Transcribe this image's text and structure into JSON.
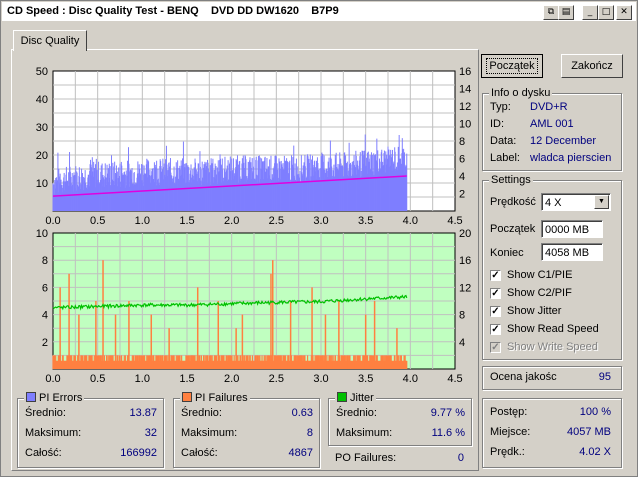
{
  "window": {
    "title": "CD Speed : Disc Quality Test - BENQ    DVD DD DW1620    B7P9"
  },
  "tabs": [
    {
      "label": "Disc Quality"
    }
  ],
  "buttons": {
    "start": "Początek",
    "exit": "Zakończ"
  },
  "disc_info": {
    "title": "Info o dysku",
    "rows": [
      {
        "label": "Typ:",
        "value": "DVD+R"
      },
      {
        "label": "ID:",
        "value": "AML 001"
      },
      {
        "label": "Data:",
        "value": "12 December"
      },
      {
        "label": "Label:",
        "value": "wladca pierscien"
      }
    ]
  },
  "settings": {
    "title": "Settings",
    "speed_label": "Prędkość",
    "speed_value": "4 X",
    "start_label": "Początek",
    "start_value": "0000 MB",
    "end_label": "Koniec",
    "end_value": "4058 MB",
    "checks": [
      {
        "label": "Show C1/PIE",
        "checked": true,
        "enabled": true
      },
      {
        "label": "Show C2/PIF",
        "checked": true,
        "enabled": true
      },
      {
        "label": "Show Jitter",
        "checked": true,
        "enabled": true
      },
      {
        "label": "Show Read Speed",
        "checked": true,
        "enabled": true
      },
      {
        "label": "Show Write Speed",
        "checked": true,
        "enabled": false
      }
    ]
  },
  "quality": {
    "label": "Ocena jakośc",
    "value": "95"
  },
  "progress": {
    "rows": [
      {
        "label": "Postęp:",
        "value": "100 %"
      },
      {
        "label": "Miejsce:",
        "value": "4057 MB"
      },
      {
        "label": "Prędk.:",
        "value": "4.02 X"
      }
    ]
  },
  "pi_errors": {
    "title": "PI Errors",
    "color": "#7f7fff",
    "rows": [
      {
        "label": "Średnio:",
        "value": "13.87"
      },
      {
        "label": "Maksimum:",
        "value": "32"
      },
      {
        "label": "Całość:",
        "value": "166992"
      }
    ]
  },
  "pi_failures": {
    "title": "PI Failures",
    "color": "#ff8040",
    "rows": [
      {
        "label": "Średnio:",
        "value": "0.63"
      },
      {
        "label": "Maksimum:",
        "value": "8"
      },
      {
        "label": "Całość:",
        "value": "4867"
      }
    ]
  },
  "jitter": {
    "title": "Jitter",
    "color": "#00c000",
    "rows": [
      {
        "label": "Średnio:",
        "value": "9.77 %"
      },
      {
        "label": "Maksimum:",
        "value": "11.6 %"
      }
    ]
  },
  "po_failures": {
    "label": "PO Failures:",
    "value": "0"
  },
  "chart_data": [
    {
      "type": "bar",
      "series_colors": {
        "pi_errors": "#7f7fff",
        "read_speed": "#e000e0"
      },
      "background": "#ffffff",
      "grid": true,
      "xlim": [
        0,
        4.5
      ],
      "x_ticks": [
        "0.0",
        "0.5",
        "1.0",
        "1.5",
        "2.0",
        "2.5",
        "3.0",
        "3.5",
        "4.0",
        "4.5"
      ],
      "ylim_left": [
        0,
        50
      ],
      "y_ticks_left": [
        "10",
        "20",
        "30",
        "40",
        "50"
      ],
      "ylim_right": [
        0,
        16
      ],
      "y_ticks_right": [
        "2",
        "4",
        "6",
        "8",
        "10",
        "12",
        "14",
        "16"
      ],
      "pi_errors_profile": [
        {
          "x": 0.0,
          "y": 10
        },
        {
          "x": 0.25,
          "y": 12
        },
        {
          "x": 0.5,
          "y": 13
        },
        {
          "x": 0.75,
          "y": 13
        },
        {
          "x": 1.0,
          "y": 14
        },
        {
          "x": 1.25,
          "y": 14
        },
        {
          "x": 1.5,
          "y": 14
        },
        {
          "x": 1.75,
          "y": 14
        },
        {
          "x": 2.0,
          "y": 15
        },
        {
          "x": 2.25,
          "y": 15
        },
        {
          "x": 2.5,
          "y": 15
        },
        {
          "x": 2.75,
          "y": 15
        },
        {
          "x": 3.0,
          "y": 16
        },
        {
          "x": 3.25,
          "y": 16
        },
        {
          "x": 3.5,
          "y": 17
        },
        {
          "x": 3.75,
          "y": 18
        },
        {
          "x": 3.96,
          "y": 19
        }
      ],
      "read_speed": [
        {
          "x": 0.0,
          "y": 1.7
        },
        {
          "x": 3.96,
          "y": 4.0
        }
      ],
      "data_end_x": 3.96
    },
    {
      "type": "bar",
      "series_colors": {
        "pi_failures": "#ff8040",
        "jitter": "#00c000"
      },
      "background": "#c0ffc0",
      "grid": true,
      "xlim": [
        0,
        4.5
      ],
      "x_ticks": [
        "0.0",
        "0.5",
        "1.0",
        "1.5",
        "2.0",
        "2.5",
        "3.0",
        "3.5",
        "4.0",
        "4.5"
      ],
      "ylim_left": [
        0,
        10
      ],
      "y_ticks_left": [
        "2",
        "4",
        "6",
        "8",
        "10"
      ],
      "ylim_right": [
        0,
        20
      ],
      "y_ticks_right": [
        "4",
        "8",
        "12",
        "16",
        "20"
      ],
      "pi_failures_profile": [
        {
          "x": 0.0,
          "y": 1
        },
        {
          "x": 0.5,
          "y": 1
        },
        {
          "x": 1.0,
          "y": 1
        },
        {
          "x": 1.5,
          "y": 1
        },
        {
          "x": 2.0,
          "y": 1
        },
        {
          "x": 2.5,
          "y": 1
        },
        {
          "x": 3.0,
          "y": 1
        },
        {
          "x": 3.5,
          "y": 1
        },
        {
          "x": 3.96,
          "y": 1
        }
      ],
      "pi_failures_spikes": [
        {
          "x": 0.08,
          "y": 6
        },
        {
          "x": 0.18,
          "y": 7
        },
        {
          "x": 0.29,
          "y": 4
        },
        {
          "x": 0.48,
          "y": 5
        },
        {
          "x": 0.56,
          "y": 8
        },
        {
          "x": 0.7,
          "y": 4
        },
        {
          "x": 0.85,
          "y": 5
        },
        {
          "x": 1.1,
          "y": 4
        },
        {
          "x": 1.3,
          "y": 3
        },
        {
          "x": 1.62,
          "y": 6
        },
        {
          "x": 1.85,
          "y": 5
        },
        {
          "x": 2.05,
          "y": 3
        },
        {
          "x": 2.12,
          "y": 4
        },
        {
          "x": 2.44,
          "y": 7
        },
        {
          "x": 2.46,
          "y": 8
        },
        {
          "x": 2.66,
          "y": 5
        },
        {
          "x": 2.9,
          "y": 6
        },
        {
          "x": 3.05,
          "y": 4
        },
        {
          "x": 3.2,
          "y": 5
        },
        {
          "x": 3.5,
          "y": 4
        },
        {
          "x": 3.6,
          "y": 5
        },
        {
          "x": 3.85,
          "y": 3
        }
      ],
      "jitter": [
        {
          "x": 0.0,
          "y": 9.0
        },
        {
          "x": 0.5,
          "y": 9.2
        },
        {
          "x": 1.0,
          "y": 9.4
        },
        {
          "x": 1.5,
          "y": 9.4
        },
        {
          "x": 2.0,
          "y": 9.6
        },
        {
          "x": 2.5,
          "y": 9.8
        },
        {
          "x": 3.0,
          "y": 9.9
        },
        {
          "x": 3.5,
          "y": 10.3
        },
        {
          "x": 3.96,
          "y": 10.6
        }
      ],
      "data_end_x": 3.96
    }
  ]
}
